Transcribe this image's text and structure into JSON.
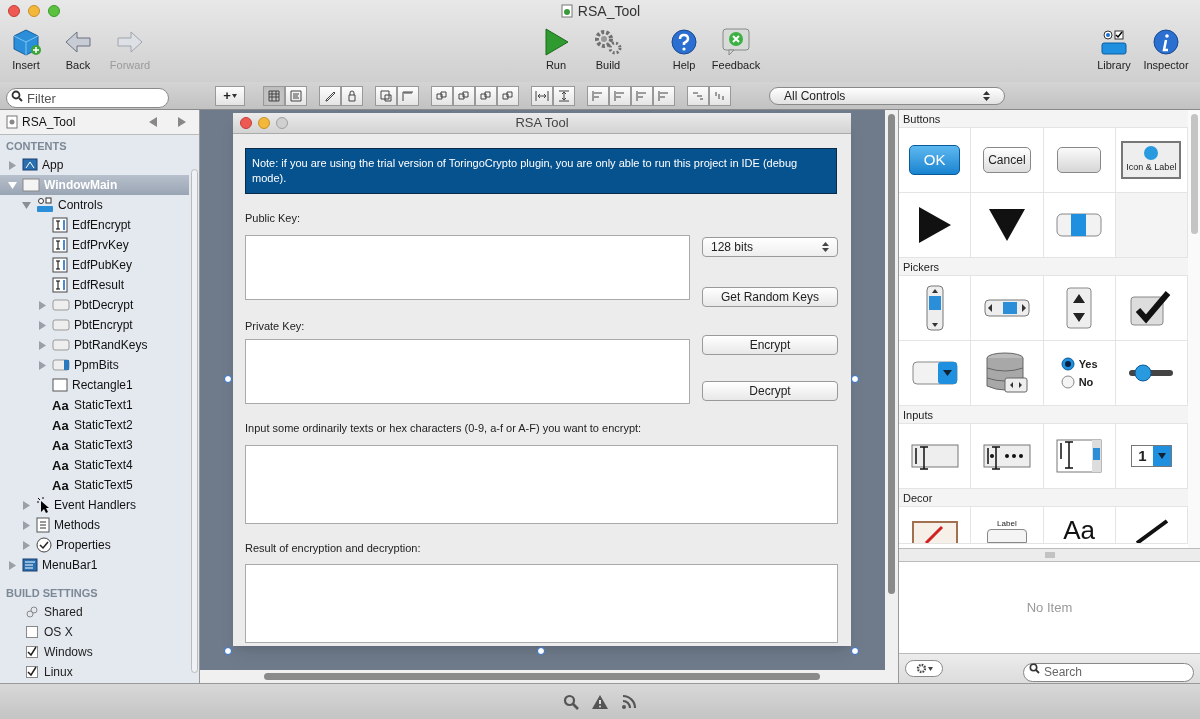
{
  "window": {
    "title": "RSA_Tool"
  },
  "toolbar": {
    "left": [
      {
        "kind": "insert",
        "label": "Insert",
        "disabled": false
      },
      {
        "kind": "back",
        "label": "Back",
        "disabled": false
      },
      {
        "kind": "forward",
        "label": "Forward",
        "disabled": true
      }
    ],
    "center": [
      {
        "kind": "run",
        "label": "Run",
        "disabled": false
      },
      {
        "kind": "build",
        "label": "Build",
        "disabled": false
      },
      {
        "kind": "help",
        "label": "Help",
        "disabled": false
      },
      {
        "kind": "feedback",
        "label": "Feedback",
        "disabled": false
      }
    ],
    "right": [
      {
        "kind": "library",
        "label": "Library",
        "disabled": false
      },
      {
        "kind": "inspector",
        "label": "Inspector",
        "disabled": false
      }
    ]
  },
  "filter": {
    "placeholder": "Filter"
  },
  "add_button": {
    "label": "+"
  },
  "view_modes": [
    {
      "kind": "grid",
      "selected": true
    },
    {
      "kind": "list",
      "selected": false
    }
  ],
  "library_filter": {
    "value": "All Controls"
  },
  "navigator": {
    "title": "RSA_Tool"
  },
  "contents": {
    "heading": "CONTENTS",
    "tree": [
      {
        "label": "App",
        "kind": "app",
        "expanded": false,
        "selected": false
      },
      {
        "label": "WindowMain",
        "kind": "window",
        "expanded": true,
        "selected": true,
        "children": [
          {
            "label": "Controls",
            "kind": "controls",
            "expanded": true,
            "selected": false,
            "children": [
              {
                "label": "EdfEncrypt",
                "kind": "textfield",
                "selected": false
              },
              {
                "label": "EdfPrvKey",
                "kind": "textfield",
                "selected": false
              },
              {
                "label": "EdfPubKey",
                "kind": "textfield",
                "selected": false
              },
              {
                "label": "EdfResult",
                "kind": "textfield",
                "selected": false
              },
              {
                "label": "PbtDecrypt",
                "kind": "button",
                "expanded": false,
                "selected": false
              },
              {
                "label": "PbtEncrypt",
                "kind": "button",
                "expanded": false,
                "selected": false
              },
              {
                "label": "PbtRandKeys",
                "kind": "button",
                "expanded": false,
                "selected": false
              },
              {
                "label": "PpmBits",
                "kind": "popup",
                "expanded": false,
                "selected": false
              },
              {
                "label": "Rectangle1",
                "kind": "rectangle",
                "selected": false
              },
              {
                "label": "StaticText1",
                "kind": "text",
                "glyph": "Aa",
                "selected": false
              },
              {
                "label": "StaticText2",
                "kind": "text",
                "glyph": "Aa",
                "selected": false
              },
              {
                "label": "StaticText3",
                "kind": "text",
                "glyph": "Aa",
                "selected": false
              },
              {
                "label": "StaticText4",
                "kind": "text",
                "glyph": "Aa",
                "selected": false
              },
              {
                "label": "StaticText5",
                "kind": "text",
                "glyph": "Aa",
                "selected": false
              }
            ]
          },
          {
            "label": "Event Handlers",
            "kind": "cursor",
            "expanded": false,
            "selected": false
          },
          {
            "label": "Methods",
            "kind": "methods",
            "expanded": false,
            "selected": false
          },
          {
            "label": "Properties",
            "kind": "properties",
            "expanded": false,
            "selected": false
          }
        ]
      },
      {
        "label": "MenuBar1",
        "kind": "menubar",
        "expanded": false,
        "selected": false
      }
    ]
  },
  "build_settings": {
    "heading": "BUILD SETTINGS",
    "items": [
      {
        "label": "Shared",
        "kind": "shared"
      },
      {
        "label": "OS X",
        "kind": "checkbox",
        "checked": false
      },
      {
        "label": "Windows",
        "kind": "checkbox",
        "checked": true
      },
      {
        "label": "Linux",
        "kind": "checkbox",
        "checked": true
      }
    ]
  },
  "form": {
    "title": "RSA Tool",
    "note": "Note: if you are using the trial version of ToringoCrypto plugin, you are only able to run this project in IDE (debug mode).",
    "public_key_label": "Public Key:",
    "private_key_label": "Private Key:",
    "bits": "128 bits",
    "buttons": [
      "Get Random Keys",
      "Encrypt",
      "Decrypt"
    ],
    "input_label": "Input some ordinarily texts or hex characters (0-9, a-f or A-F) you want to encrypt:",
    "result_label": "Result of encryption and decryption:"
  },
  "library": {
    "sections": [
      {
        "title": "Buttons",
        "items": [
          {
            "kind": "ok",
            "label": "OK"
          },
          {
            "kind": "cancel",
            "label": "Cancel"
          },
          {
            "kind": "plain"
          },
          {
            "kind": "iconlabel",
            "label": "Icon & Label"
          },
          {
            "kind": "play"
          },
          {
            "kind": "down"
          },
          {
            "kind": "segmented"
          },
          {
            "kind": "empty"
          }
        ]
      },
      {
        "title": "Pickers",
        "items": [
          {
            "kind": "vscroll"
          },
          {
            "kind": "hscroll"
          },
          {
            "kind": "updown"
          },
          {
            "kind": "check"
          },
          {
            "kind": "popup"
          },
          {
            "kind": "database"
          },
          {
            "kind": "radio",
            "label": "Yes",
            "label2": "No"
          },
          {
            "kind": "slider"
          }
        ]
      },
      {
        "title": "Inputs",
        "items": [
          {
            "kind": "textfield"
          },
          {
            "kind": "password"
          },
          {
            "kind": "textarea"
          },
          {
            "kind": "combo",
            "label": "1"
          }
        ]
      },
      {
        "title": "Decor",
        "items": [
          {
            "kind": "picture"
          },
          {
            "kind": "labelbox",
            "label": "Label"
          },
          {
            "kind": "bigtext",
            "label": "Aa"
          },
          {
            "kind": "line"
          }
        ]
      }
    ]
  },
  "inspector": {
    "empty_text": "No Item",
    "search_placeholder": "Search"
  }
}
